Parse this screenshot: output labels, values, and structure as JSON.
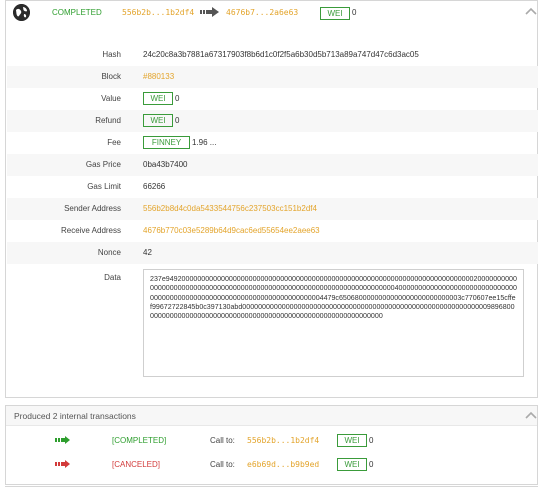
{
  "header": {
    "status": "COMPLETED",
    "from_short": "556b2b...1b2df4",
    "to_short": "4676b7...2a6e63",
    "unit": "WEI",
    "value": "0"
  },
  "details": {
    "hash": {
      "label": "Hash",
      "value": "24c20c8a3b7881a67317903f8b6d1c0f2f5a6b30d5b713a89a747d47c6d3ac05"
    },
    "block": {
      "label": "Block",
      "value": "#880133"
    },
    "value": {
      "label": "Value",
      "unit": "WEI",
      "amount": "0"
    },
    "refund": {
      "label": "Refund",
      "unit": "WEI",
      "amount": "0"
    },
    "fee": {
      "label": "Fee",
      "unit": "FINNEY",
      "amount": "1.96 ..."
    },
    "gas_price": {
      "label": "Gas Price",
      "value": "0ba43b7400"
    },
    "gas_limit": {
      "label": "Gas Limit",
      "value": "66266"
    },
    "sender": {
      "label": "Sender Address",
      "value": "556b2b8d4c0da5433544756c237503cc151b2df4"
    },
    "receiver": {
      "label": "Receive Address",
      "value": "4676b770c03e5289b64d9cac6ed55654ee2aee63"
    },
    "nonce": {
      "label": "Nonce",
      "value": "42"
    },
    "data": {
      "label": "Data",
      "value": "237e9492000000000000000000000000000000000000000000000000000000000000000000000000002000000000000000000000000000000000000000000000000000000000000000000000000400000000000000000000000000000000000000000000000000000000000000000000000004479c6506800000000000000000000000003c770607ee15cffef99672722845b0c397130abd00000000000000000000000000000000000000000000000000000000000000989680000000000000000000000000000000000000000000000000000000000000"
    }
  },
  "internal": {
    "title": "Produced 2 internal transactions",
    "items": [
      {
        "status": "[COMPLETED]",
        "call_to_label": "Call to:",
        "address": "556b2b...1b2df4",
        "unit": "WEI",
        "value": "0"
      },
      {
        "status": "[CANCELED]",
        "call_to_label": "Call to:",
        "address": "e6b69d...b9b9ed",
        "unit": "WEI",
        "value": "0"
      }
    ]
  },
  "colors": {
    "completed": "#2e9e2e",
    "canceled": "#d23a3a",
    "address": "#e3a42b",
    "badge_border": "#3a9b3a"
  },
  "icons": {
    "status_globe": "globe-icon",
    "flow_arrow": "arrow-right-icon",
    "collapse": "chevron-up-icon",
    "internal_ok_arrow": "green-arrow-icon",
    "internal_fail_arrow": "red-arrow-icon"
  }
}
